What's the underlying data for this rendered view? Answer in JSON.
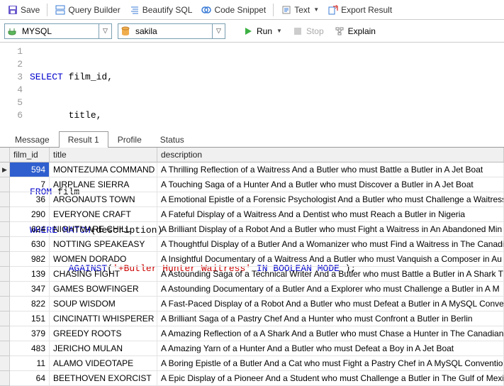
{
  "toolbar": {
    "save": "Save",
    "query_builder": "Query Builder",
    "beautify": "Beautify SQL",
    "code_snippet": "Code Snippet",
    "text": "Text",
    "export": "Export Result"
  },
  "conn": {
    "db_type": "MYSQL",
    "schema": "sakila",
    "run": "Run",
    "stop": "Stop",
    "explain": "Explain"
  },
  "sql": {
    "l1a": "SELECT",
    "l1b": " film_id,",
    "l2": "       title,",
    "l3": "       description",
    "l4a": "FROM",
    "l4b": " film",
    "l5a": "WHERE",
    "l5b": " ",
    "l5c": "MATCH",
    "l5d": "(description)",
    "l6a": "       ",
    "l6b": "AGAINST",
    "l6c": "(",
    "l6d": "'+Butler Hunter Waitress'",
    "l6e": " ",
    "l6f": "IN",
    "l6g": " ",
    "l6h": "BOOLEAN",
    "l6i": " ",
    "l6j": "MODE",
    "l6k": " );"
  },
  "tabs": {
    "message": "Message",
    "result": "Result 1",
    "profile": "Profile",
    "status": "Status"
  },
  "columns": {
    "film_id": "film_id",
    "title": "title",
    "description": "description"
  },
  "rows": [
    {
      "id": "594",
      "title": "MONTEZUMA COMMAND",
      "desc": "A Thrilling Reflection of a Waitress And a Butler who must Battle a Butler in A Jet Boat"
    },
    {
      "id": "7",
      "title": "AIRPLANE SIERRA",
      "desc": "A Touching Saga of a Hunter And a Butler who must Discover a Butler in A Jet Boat"
    },
    {
      "id": "36",
      "title": "ARGONAUTS TOWN",
      "desc": "A Emotional Epistle of a Forensic Psychologist And a Butler who must Challenge a Waitress"
    },
    {
      "id": "290",
      "title": "EVERYONE CRAFT",
      "desc": "A Fateful Display of a Waitress And a Dentist who must Reach a Butler in Nigeria"
    },
    {
      "id": "624",
      "title": "NIGHTMARE CHILL",
      "desc": "A Brilliant Display of a Robot And a Butler who must Fight a Waitress in An Abandoned Min"
    },
    {
      "id": "630",
      "title": "NOTTING SPEAKEASY",
      "desc": "A Thoughtful Display of a Butler And a Womanizer who must Find a Waitress in The Canadi"
    },
    {
      "id": "982",
      "title": "WOMEN DORADO",
      "desc": "A Insightful Documentary of a Waitress And a Butler who must Vanquish a Composer in Au"
    },
    {
      "id": "139",
      "title": "CHASING FIGHT",
      "desc": "A Astounding Saga of a Technical Writer And a Butler who must Battle a Butler in A Shark T"
    },
    {
      "id": "347",
      "title": "GAMES BOWFINGER",
      "desc": "A Astounding Documentary of a Butler And a Explorer who must Challenge a Butler in A M"
    },
    {
      "id": "822",
      "title": "SOUP WISDOM",
      "desc": "A Fast-Paced Display of a Robot And a Butler who must Defeat a Butler in A MySQL Conver"
    },
    {
      "id": "151",
      "title": "CINCINATTI WHISPERER",
      "desc": "A Brilliant Saga of a Pastry Chef And a Hunter who must Confront a Butler in Berlin"
    },
    {
      "id": "379",
      "title": "GREEDY ROOTS",
      "desc": "A Amazing Reflection of a A Shark And a Butler who must Chase a Hunter in The Canadian"
    },
    {
      "id": "483",
      "title": "JERICHO MULAN",
      "desc": "A Amazing Yarn of a Hunter And a Butler who must Defeat a Boy in A Jet Boat"
    },
    {
      "id": "11",
      "title": "ALAMO VIDEOTAPE",
      "desc": "A Boring Epistle of a Butler And a Cat who must Fight a Pastry Chef in A MySQL Convention"
    },
    {
      "id": "64",
      "title": "BEETHOVEN EXORCIST",
      "desc": "A Epic Display of a Pioneer And a Student who must Challenge a Butler in The Gulf of Mexic"
    }
  ]
}
